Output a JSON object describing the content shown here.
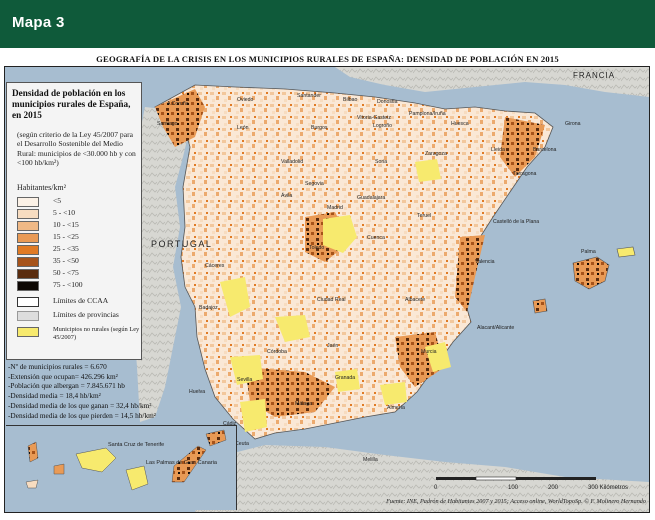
{
  "header": {
    "title": "Mapa 3",
    "background": "#0f5a3a"
  },
  "map": {
    "title": "GEOGRAFÍA DE LA CRISIS EN LOS MUNICIPIOS RURALES DE ESPAÑA: DENSIDAD DE POBLACIÓN  EN 2015",
    "country_labels": {
      "francia": "FRANCIA",
      "portugal": "PORTUGAL"
    },
    "city_labels": [
      "A Coruña",
      "Santiago",
      "Oviedo",
      "Santander",
      "Bilbao",
      "Donostia",
      "Vitoria-Gasteiz",
      "Pamplona/Iruña",
      "Logroño",
      "León",
      "Burgos",
      "Huesca",
      "Girona",
      "Zaragoza",
      "Barcelona",
      "Valladolid",
      "Soria",
      "Lleida",
      "Tarragona",
      "Segovia",
      "Ávila",
      "Madrid",
      "Guadalajara",
      "Teruel",
      "Castelló de la Plana",
      "Cuenca",
      "Toledo",
      "Valencia",
      "Cáceres",
      "Palma",
      "Badajoz",
      "Ciudad Real",
      "Albacete",
      "Alacant/Alicante",
      "Córdoba",
      "Jaén",
      "Murcia",
      "Sevilla",
      "Granada",
      "Huelva",
      "Málaga",
      "Almería",
      "Cádiz",
      "Ceuta",
      "Melilla",
      "Santa Cruz de Tenerife",
      "Las Palmas de Gran Canaria"
    ]
  },
  "legend": {
    "title": "Densidad de población en los municipios rurales de España, en 2015",
    "subtitle": "(según criterio de la Ley 45/2007 para el Desarrollo Sostenible del Medio Rural: municipios de <30.000 hb y con <100 hb/km²)",
    "unit": "Habitantes/km²",
    "items": [
      {
        "label": "<5",
        "color": "#fbf1e6"
      },
      {
        "label": "5 - <10",
        "color": "#f7dcc0"
      },
      {
        "label": "10 - <15",
        "color": "#f0b986"
      },
      {
        "label": "15 - <25",
        "color": "#e99a55"
      },
      {
        "label": "25 - <35",
        "color": "#e07a24"
      },
      {
        "label": "35 - <50",
        "color": "#a6531a"
      },
      {
        "label": "50 - <75",
        "color": "#5a2c0e"
      },
      {
        "label": "75 - <100",
        "color": "#0d0703"
      },
      {
        "label": "Límites de CCAA",
        "color": "#ffffff"
      },
      {
        "label": "Límites de provincias",
        "color": "#dddddd"
      },
      {
        "label": "Municipios no rurales (según Ley 45/2007)",
        "color": "#f7ea6e"
      }
    ]
  },
  "stats": [
    "-Nº de municipios rurales = 6.670",
    "-Extensión que ocupan= 426.296 km²",
    "-Población que albergan = 7.845.671 hb",
    "-Densidad media = 18,4 hb/km²",
    "-Densidad media de los que ganan = 32,4 hb/km²",
    "-Densidad media de los que pierden = 14,5 hb/km²"
  ],
  "scale": {
    "ticks": [
      "0",
      "100",
      "200",
      "300 Kilómetros"
    ]
  },
  "source": "Fuente: INE, Padrón de Habitantes 2007 y 2015; Acceso online, WorldTopoSp.   © F. Molinero Hernando"
}
